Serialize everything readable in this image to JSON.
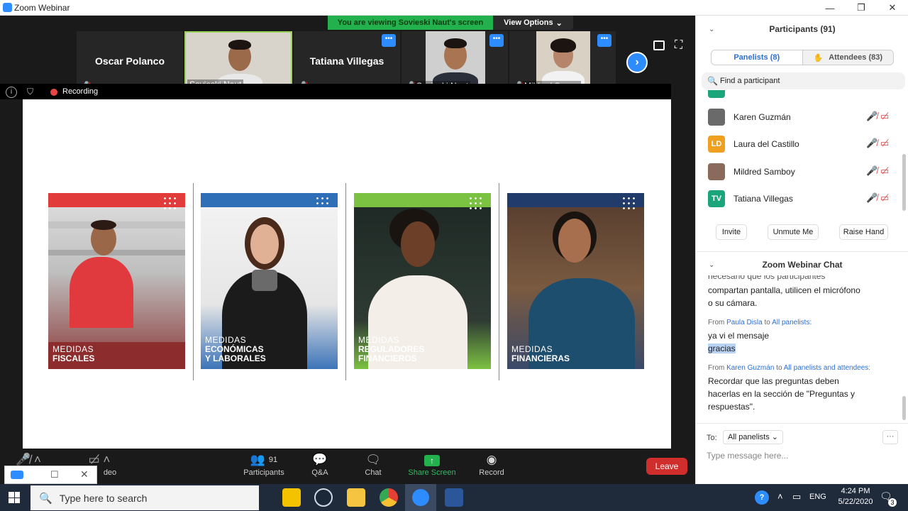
{
  "window": {
    "title": "Zoom Webinar",
    "controls": [
      "—",
      "❐",
      "✕"
    ]
  },
  "banner": {
    "message": "You are viewing Sovieski Naut's screen",
    "options_label": "View Options"
  },
  "thumbnails": [
    {
      "name": "Oscar Polanco",
      "label": "",
      "video": false
    },
    {
      "name": "",
      "label": "Sovieski Naut",
      "video": true
    },
    {
      "name": "Tatiana Villegas",
      "label": "",
      "video": false
    },
    {
      "name": "",
      "label": "Sovieski Naut",
      "video": true
    },
    {
      "name": "",
      "label": "Mildred Sam...",
      "video": true
    }
  ],
  "screen_bar": {
    "recording_label": "Recording"
  },
  "slides": [
    {
      "line1": "MEDIDAS",
      "line2": "FISCALES",
      "line3": "",
      "band_color": "#e23b3b"
    },
    {
      "line1": "MEDIDAS",
      "line2": "ECONÓMICAS",
      "line3": "Y LABORALES",
      "band_color": "#2f6fb8"
    },
    {
      "line1": "MEDIDAS",
      "line2": "REGULADORES",
      "line3": "FINANCIEROS",
      "band_color": "#7cc242"
    },
    {
      "line1": "MEDIDAS",
      "line2": "FINANCIERAS",
      "line3": "",
      "band_color": "#213b6b"
    }
  ],
  "toolbar": {
    "participants_count": "91",
    "participants_label": "Participants",
    "qa_label": "Q&A",
    "chat_label": "Chat",
    "share_label": "Share Screen",
    "record_label": "Record",
    "video_label": "deo",
    "leave_label": "Leave"
  },
  "panel": {
    "participants_title": "Participants (91)",
    "tab_panelists": "Panelists (8)",
    "tab_attendees": "Attendees (83)",
    "search_placeholder": "Find a participant",
    "participants": [
      {
        "name": "Karen Guzmán",
        "initials": "",
        "color": "#6a6a6a"
      },
      {
        "name": "Laura del Castillo",
        "initials": "LD",
        "color": "#f0a020"
      },
      {
        "name": "Mildred Samboy",
        "initials": "",
        "color": "#8a6a5a"
      },
      {
        "name": "Tatiana Villegas",
        "initials": "TV",
        "color": "#1aa57a"
      }
    ],
    "invite_label": "Invite",
    "unmute_label": "Unmute Me",
    "raise_label": "Raise Hand",
    "chat_title": "Zoom Webinar Chat",
    "chat": {
      "partial_line": "necesario que los participantes",
      "line1": "compartan pantalla, utilicen el micrófono",
      "line2": "o su cámara.",
      "from_label": "From",
      "to_label": "to",
      "sender1": "Paula Disla",
      "recipient1": "All panelists:",
      "msg1a": "ya vi el mensaje",
      "msg1b": "gracias",
      "sender2": "Karen Guzmán",
      "recipient2": "All panelists and attendees:",
      "msg2a": "Recordar que las preguntas deben",
      "msg2b": "hacerlas en la sección de \"Preguntas y",
      "msg2c": "respuestas\"."
    },
    "to_prefix": "To:",
    "to_value": "All panelists",
    "message_placeholder": "Type message here..."
  },
  "taskbar": {
    "search_placeholder": "Type here to search",
    "time": "4:24 PM",
    "date": "5/22/2020",
    "lang": "ENG",
    "notifications": "3"
  }
}
